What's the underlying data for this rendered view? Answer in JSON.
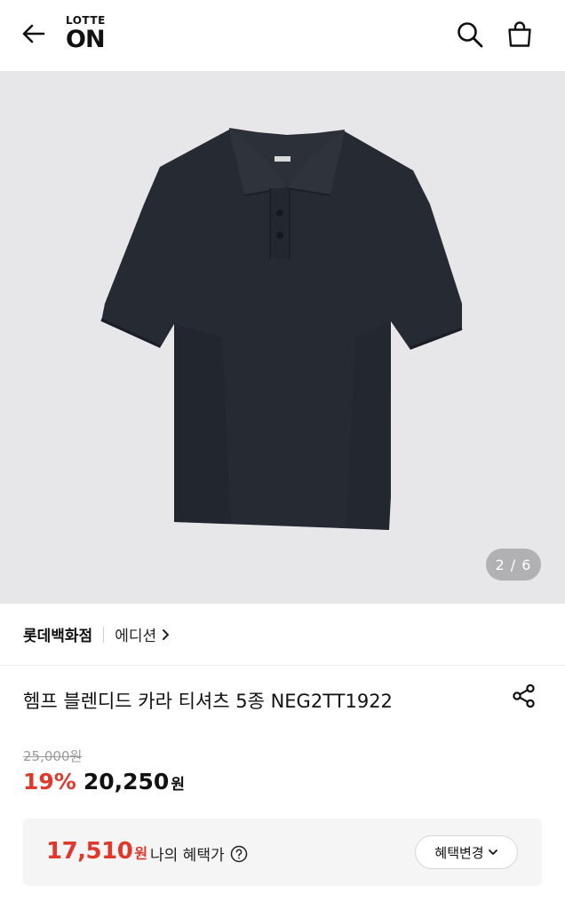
{
  "header": {
    "logo_top": "LOTTE",
    "logo_bottom": "ON",
    "icons": {
      "back": "arrow-left-icon",
      "search": "search-icon",
      "cart": "shopping-bag-icon"
    }
  },
  "gallery": {
    "current": 2,
    "total": 6,
    "counter_text": "2 / 6",
    "background_color": "#e7e7e9"
  },
  "store": {
    "name": "롯데백화점",
    "brand": "에디션"
  },
  "product": {
    "title": "헴프 블렌디드 카라 티셔츠 5종 NEG2TT1922"
  },
  "price": {
    "original": "25,000원",
    "discount": "19%",
    "sale": "20,250",
    "sale_unit": "원"
  },
  "benefit": {
    "amount": "17,510",
    "unit": "원",
    "label": "나의 혜택가",
    "change_label": "혜택변경"
  },
  "colors": {
    "accent": "#e0392c",
    "text": "#111111"
  }
}
